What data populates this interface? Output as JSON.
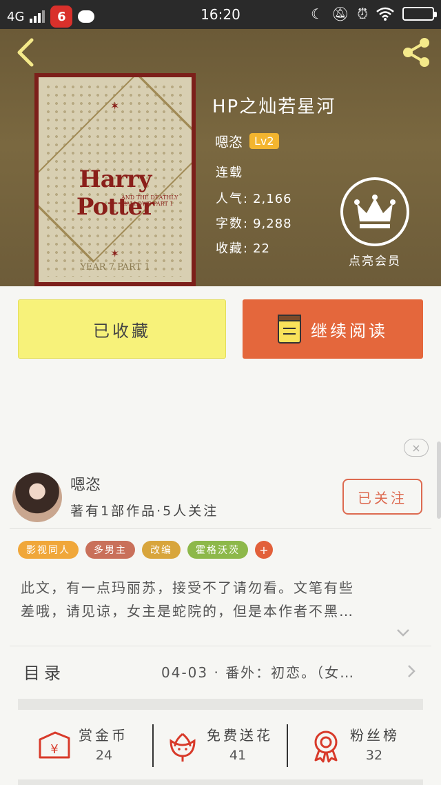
{
  "status_bar": {
    "network": "4G",
    "time": "16:20",
    "app_icon_letter": "6"
  },
  "book": {
    "title": "HP之灿若星河",
    "cover": {
      "title": "Harry Potter",
      "subtitle": "AND THE DEATHLY HALLOWS PART 1",
      "year": "YEAR 7 PART 1"
    },
    "author": "嗯恣",
    "level": "Lv2",
    "status": "连载",
    "popularity_label": "人气:",
    "popularity": "2,166",
    "words_label": "字数:",
    "words": "9,288",
    "favorites_label": "收藏:",
    "favorites": "22",
    "vip_label": "点亮会员"
  },
  "actions": {
    "favorited_label": "已收藏",
    "continue_label": "继续阅读"
  },
  "ad_close": "×",
  "author_card": {
    "name": "嗯恣",
    "stats": "著有1部作品·5人关注",
    "follow_label": "已关注"
  },
  "tags": [
    {
      "label": "影视同人",
      "color": "#f0a73a"
    },
    {
      "label": "多男主",
      "color": "#c9705a"
    },
    {
      "label": "改编",
      "color": "#d8a53c"
    },
    {
      "label": "霍格沃茨",
      "color": "#8db84a"
    }
  ],
  "tag_more": "+",
  "intro": {
    "line1": "此文，有一点玛丽苏，接受不了请勿看。文笔有些",
    "line2": "差哦，请见谅，女主是蛇院的，但是本作者不黑…"
  },
  "toc": {
    "label": "目录",
    "latest": "04-03 · 番外：初恋。（女…"
  },
  "stats": {
    "reward": {
      "label": "赏金币",
      "value": "24"
    },
    "flowers": {
      "label": "免费送花",
      "value": "41"
    },
    "fans": {
      "label": "粉丝榜",
      "value": "32"
    }
  },
  "colors": {
    "accent_orange": "#e4673c",
    "favorite_yellow": "#f7f27a",
    "level_badge": "#f3b52f",
    "icon_red": "#d83a2a"
  }
}
